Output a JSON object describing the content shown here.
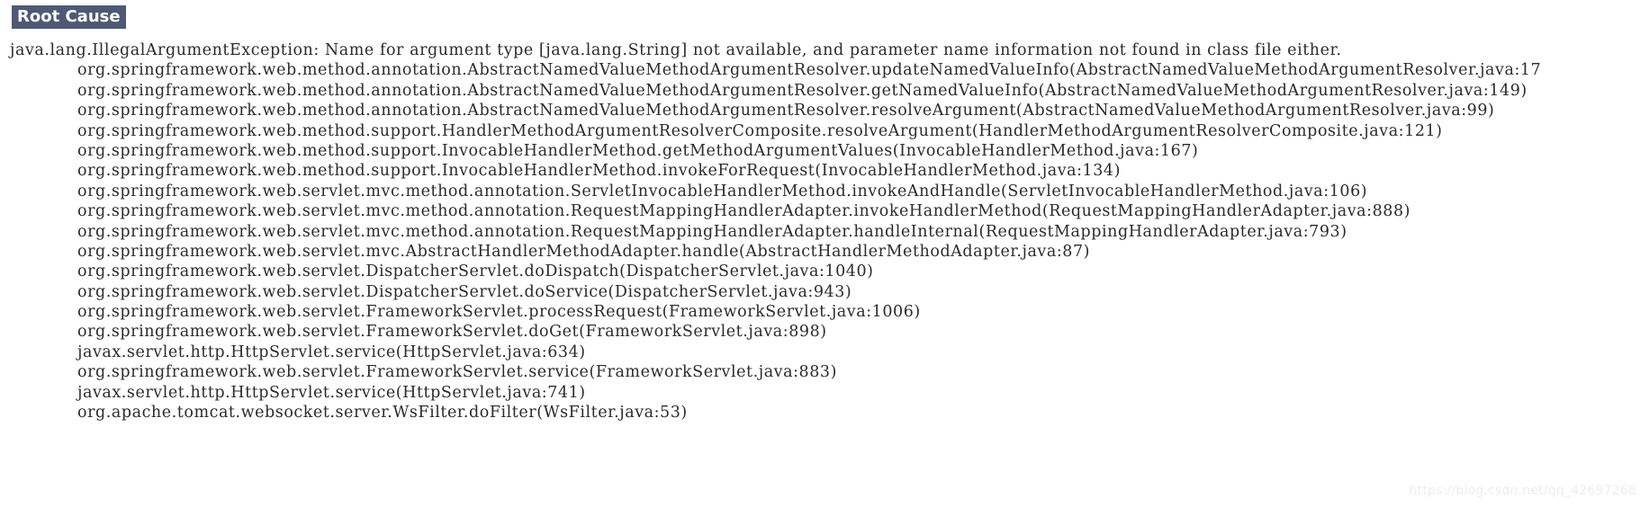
{
  "section": {
    "heading": "Root Cause",
    "heading_bg": "#4e5a75",
    "heading_fg": "#ffffff"
  },
  "stack_trace": {
    "exception_line": "java.lang.IllegalArgumentException: Name for argument type [java.lang.String] not available, and parameter name information not found in class file either.",
    "frames": [
      "org.springframework.web.method.annotation.AbstractNamedValueMethodArgumentResolver.updateNamedValueInfo(AbstractNamedValueMethodArgumentResolver.java:17",
      "org.springframework.web.method.annotation.AbstractNamedValueMethodArgumentResolver.getNamedValueInfo(AbstractNamedValueMethodArgumentResolver.java:149)",
      "org.springframework.web.method.annotation.AbstractNamedValueMethodArgumentResolver.resolveArgument(AbstractNamedValueMethodArgumentResolver.java:99)",
      "org.springframework.web.method.support.HandlerMethodArgumentResolverComposite.resolveArgument(HandlerMethodArgumentResolverComposite.java:121)",
      "org.springframework.web.method.support.InvocableHandlerMethod.getMethodArgumentValues(InvocableHandlerMethod.java:167)",
      "org.springframework.web.method.support.InvocableHandlerMethod.invokeForRequest(InvocableHandlerMethod.java:134)",
      "org.springframework.web.servlet.mvc.method.annotation.ServletInvocableHandlerMethod.invokeAndHandle(ServletInvocableHandlerMethod.java:106)",
      "org.springframework.web.servlet.mvc.method.annotation.RequestMappingHandlerAdapter.invokeHandlerMethod(RequestMappingHandlerAdapter.java:888)",
      "org.springframework.web.servlet.mvc.method.annotation.RequestMappingHandlerAdapter.handleInternal(RequestMappingHandlerAdapter.java:793)",
      "org.springframework.web.servlet.mvc.AbstractHandlerMethodAdapter.handle(AbstractHandlerMethodAdapter.java:87)",
      "org.springframework.web.servlet.DispatcherServlet.doDispatch(DispatcherServlet.java:1040)",
      "org.springframework.web.servlet.DispatcherServlet.doService(DispatcherServlet.java:943)",
      "org.springframework.web.servlet.FrameworkServlet.processRequest(FrameworkServlet.java:1006)",
      "org.springframework.web.servlet.FrameworkServlet.doGet(FrameworkServlet.java:898)",
      "javax.servlet.http.HttpServlet.service(HttpServlet.java:634)",
      "org.springframework.web.servlet.FrameworkServlet.service(FrameworkServlet.java:883)",
      "javax.servlet.http.HttpServlet.service(HttpServlet.java:741)",
      "org.apache.tomcat.websocket.server.WsFilter.doFilter(WsFilter.java:53)"
    ]
  },
  "watermark": {
    "text": "https://blog.csdn.net/qq_42697268"
  }
}
